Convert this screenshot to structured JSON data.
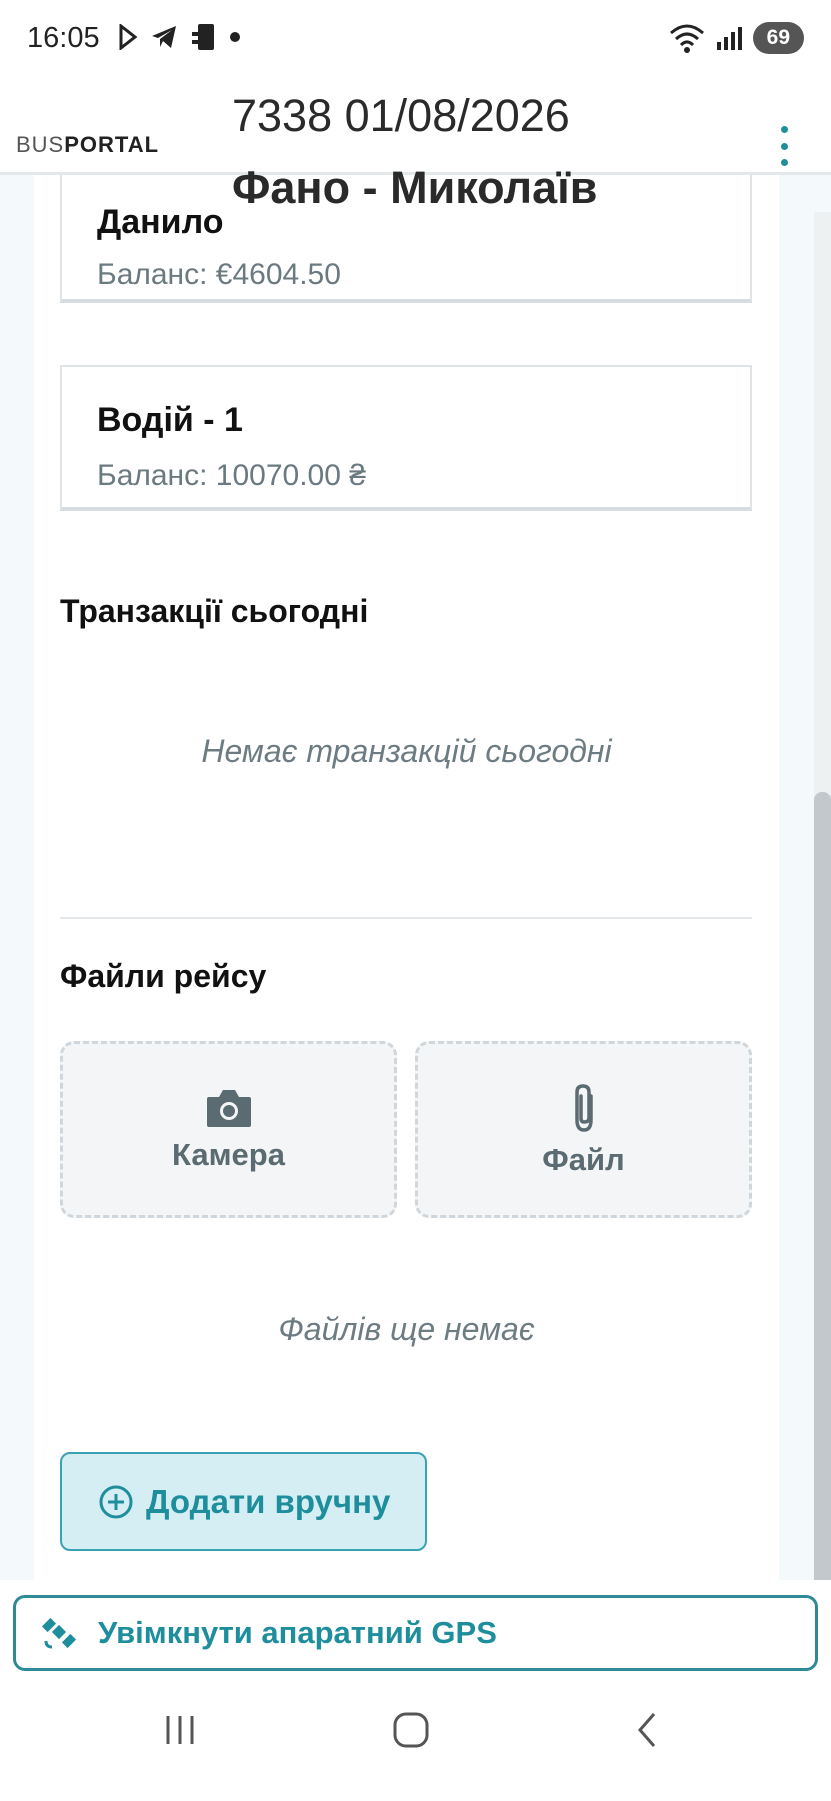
{
  "status_bar": {
    "time": "16:05",
    "battery": "69",
    "icons_left": [
      "play-store-icon",
      "telegram-icon",
      "device-icon",
      "dot-icon"
    ],
    "icons_right": [
      "wifi-icon",
      "signal-icon",
      "battery-icon"
    ]
  },
  "header": {
    "logo_bus": "BUS",
    "logo_portal": "PORTAL",
    "trip": "7338 01/08/2026",
    "route": "Фано - Миколаїв",
    "accent_color": "#1f8f9c"
  },
  "balances": [
    {
      "name": "Данило",
      "balance": "Баланс: €4604.50"
    },
    {
      "name": "Водій - 1",
      "balance": "Баланс: 10070.00 ₴"
    }
  ],
  "transactions": {
    "title": "Транзакції сьогодні",
    "empty": "Немає транзакцій сьогодні"
  },
  "files": {
    "title": "Файли рейсу",
    "camera_label": "Камера",
    "file_label": "Файл",
    "empty": "Файлів ще немає"
  },
  "add_manual_label": "Додати вручну",
  "gps_label": "Увімкнути апаратний GPS"
}
